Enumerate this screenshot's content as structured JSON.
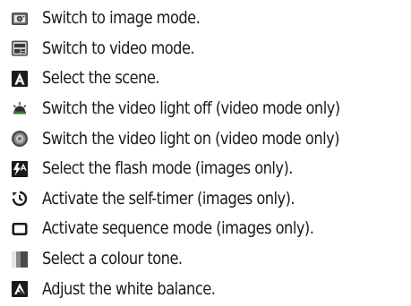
{
  "items": [
    {
      "icon": "camera-image-mode-icon",
      "label": "Switch to image mode."
    },
    {
      "icon": "video-mode-icon",
      "label": "Switch to video mode."
    },
    {
      "icon": "scene-icon",
      "label": "Select the scene."
    },
    {
      "icon": "video-light-off-icon",
      "label": "Switch the video light off (video mode only)"
    },
    {
      "icon": "video-light-on-icon",
      "label": "Switch the video light on (video mode only)"
    },
    {
      "icon": "flash-mode-icon",
      "label": "Select the flash mode (images only)."
    },
    {
      "icon": "self-timer-icon",
      "label": "Activate the self-timer (images only)."
    },
    {
      "icon": "sequence-mode-icon",
      "label": "Activate sequence mode (images only)."
    },
    {
      "icon": "colour-tone-icon",
      "label": "Select a colour tone."
    },
    {
      "icon": "white-balance-icon",
      "label": "Adjust the white balance."
    }
  ]
}
